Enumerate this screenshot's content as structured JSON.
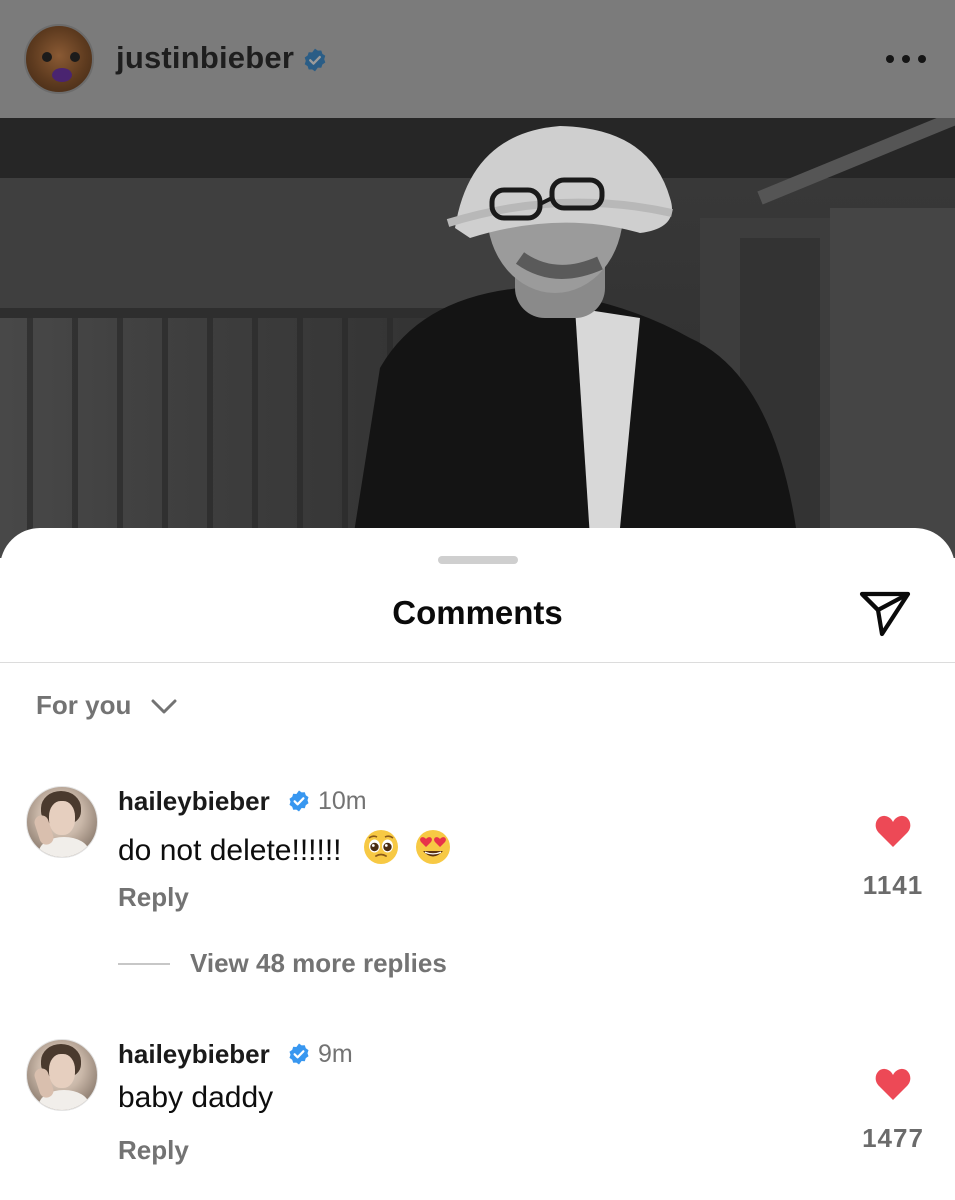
{
  "post": {
    "username": "justinbieber",
    "verified": true,
    "more_icon": "more-horizontal-icon"
  },
  "sheet": {
    "title": "Comments",
    "share_icon": "paper-plane-icon"
  },
  "filter": {
    "label": "For you",
    "icon": "chevron-down-icon"
  },
  "comments": [
    {
      "username": "haileybieber",
      "verified": true,
      "time": "10m",
      "text": "do not delete!!!!!!",
      "emojis": [
        "pleading-face-emoji",
        "heart-eyes-emoji"
      ],
      "reply_label": "Reply",
      "likes": "1141",
      "heart_color": "#ed4956"
    },
    {
      "username": "haileybieber",
      "verified": true,
      "time": "9m",
      "text": "baby daddy",
      "reply_label": "Reply",
      "likes": "1477",
      "heart_color": "#ed4956"
    }
  ],
  "view_more_replies": "View 48 more replies",
  "colors": {
    "verified_blue": "#3897f0",
    "like_red": "#ed4956",
    "muted_text": "#737373"
  }
}
